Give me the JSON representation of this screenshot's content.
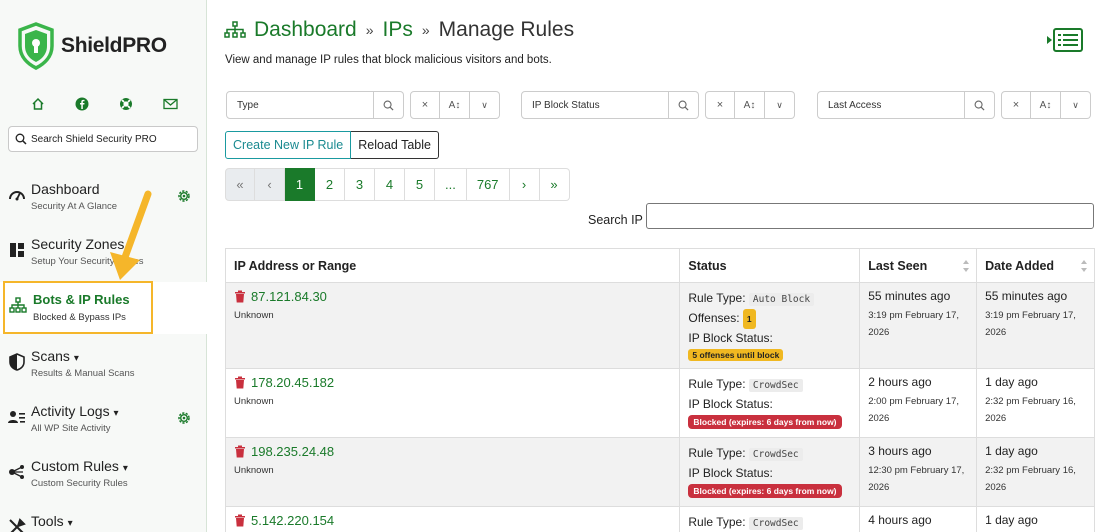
{
  "brand": {
    "name": "ShieldPRO",
    "name_a": "Shield",
    "name_b": "PRO"
  },
  "sidebar": {
    "quick_icons": [
      "home-icon",
      "facebook-icon",
      "lifebuoy-icon",
      "envelope-icon"
    ],
    "search_placeholder": "Search Shield Security PRO",
    "items": [
      {
        "title": "Dashboard",
        "sub": "Security At A Glance",
        "icon": "speedometer-icon",
        "gear": true
      },
      {
        "title": "Security Zones",
        "sub": "Setup Your Security Zones",
        "icon": "grid-icon",
        "gear": false
      },
      {
        "title": "Bots & IP Rules",
        "sub": "Blocked & Bypass IPs",
        "icon": "sitemap-icon",
        "active": true
      },
      {
        "title": "Scans",
        "caret": "▾",
        "sub": "Results & Manual Scans",
        "icon": "shield-half-icon"
      },
      {
        "title": "Activity Logs",
        "caret": "▾",
        "sub": "All WP Site Activity",
        "icon": "person-list-icon",
        "gear": true
      },
      {
        "title": "Custom Rules",
        "caret": "▾",
        "sub": "Custom Security Rules",
        "icon": "nodes-icon"
      },
      {
        "title": "Tools",
        "caret": "▾",
        "sub": "",
        "icon": "tools-icon"
      }
    ]
  },
  "header": {
    "crumbs": [
      "Dashboard",
      "IPs"
    ],
    "separator": "»",
    "current": "Manage Rules",
    "subtitle": "View and manage IP rules that block malicious visitors and bots."
  },
  "filters": [
    {
      "placeholder": "Type"
    },
    {
      "placeholder": "IP Block Status"
    },
    {
      "placeholder": "Last Access"
    }
  ],
  "buttons": {
    "create": "Create New IP Rule",
    "reload": "Reload Table"
  },
  "pagination": [
    "«",
    "‹",
    "1",
    "2",
    "3",
    "4",
    "5",
    "...",
    "767",
    "›",
    "»"
  ],
  "pagination_active": "1",
  "search_ip_label": "Search IP",
  "table": {
    "headers": [
      "IP Address or Range",
      "Status",
      "Last Seen",
      "Date Added"
    ],
    "rows": [
      {
        "ip": "87.121.84.30",
        "ip_sub": "Unknown",
        "rule_type_label": "Rule Type:",
        "rule_type": "Auto Block",
        "offenses_label": "Offenses:",
        "offenses": "1",
        "block_label": "IP Block Status:",
        "block_badge": "5 offenses until block",
        "badge_kind": "yellow",
        "last_seen": "55 minutes ago",
        "last_seen_sub": "3:19 pm February 17, 2026",
        "added": "55 minutes ago",
        "added_sub": "3:19 pm February 17, 2026"
      },
      {
        "ip": "178.20.45.182",
        "ip_sub": "Unknown",
        "rule_type_label": "Rule Type:",
        "rule_type": "CrowdSec",
        "block_label": "IP Block Status:",
        "block_badge": "Blocked (expires: 6 days from now)",
        "badge_kind": "red",
        "last_seen": "2 hours ago",
        "last_seen_sub": "2:00 pm February 17, 2026",
        "added": "1 day ago",
        "added_sub": "2:32 pm February 16, 2026"
      },
      {
        "ip": "198.235.24.48",
        "ip_sub": "Unknown",
        "rule_type_label": "Rule Type:",
        "rule_type": "CrowdSec",
        "block_label": "IP Block Status:",
        "block_badge": "Blocked (expires: 6 days from now)",
        "badge_kind": "red",
        "last_seen": "3 hours ago",
        "last_seen_sub": "12:30 pm February 17, 2026",
        "added": "1 day ago",
        "added_sub": "2:32 pm February 16, 2026"
      },
      {
        "ip": "5.142.220.154",
        "ip_sub": "",
        "rule_type_label": "Rule Type:",
        "rule_type": "CrowdSec",
        "last_seen": "4 hours ago",
        "last_seen_sub": "",
        "added": "1 day ago",
        "added_sub": ""
      }
    ]
  },
  "colors": {
    "accent": "#1a7a2a",
    "highlight": "#f5b62a",
    "danger": "#c9303e",
    "warning": "#f0b821"
  }
}
